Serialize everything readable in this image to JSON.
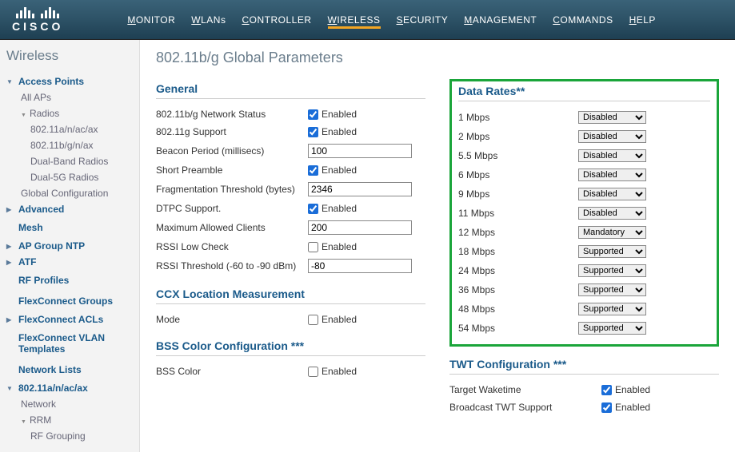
{
  "logo_text": "CISCO",
  "nav": [
    "MONITOR",
    "WLANs",
    "CONTROLLER",
    "WIRELESS",
    "SECURITY",
    "MANAGEMENT",
    "COMMANDS",
    "HELP"
  ],
  "nav_active": "WIRELESS",
  "sidebar": {
    "title": "Wireless",
    "items": [
      {
        "label": "Access Points",
        "type": "top",
        "expanded": true,
        "children": [
          {
            "label": "All APs",
            "type": "sub"
          },
          {
            "label": "Radios",
            "type": "sub",
            "expanded": true,
            "children": [
              {
                "label": "802.11a/n/ac/ax",
                "type": "sub2"
              },
              {
                "label": "802.11b/g/n/ax",
                "type": "sub2"
              },
              {
                "label": "Dual-Band Radios",
                "type": "sub2"
              },
              {
                "label": "Dual-5G Radios",
                "type": "sub2"
              }
            ]
          },
          {
            "label": "Global Configuration",
            "type": "sub"
          }
        ]
      },
      {
        "label": "Advanced",
        "type": "top",
        "expanded": false
      },
      {
        "label": "Mesh",
        "type": "top-nochevron"
      },
      {
        "label": "AP Group NTP",
        "type": "top",
        "expanded": false
      },
      {
        "label": "ATF",
        "type": "top",
        "expanded": false
      },
      {
        "label": "RF Profiles",
        "type": "top-nochevron"
      },
      {
        "label": "FlexConnect Groups",
        "type": "top-nochevron"
      },
      {
        "label": "FlexConnect ACLs",
        "type": "top",
        "expanded": false
      },
      {
        "label": "FlexConnect VLAN Templates",
        "type": "top-nochevron"
      },
      {
        "label": "Network Lists",
        "type": "top-nochevron"
      },
      {
        "label": "802.11a/n/ac/ax",
        "type": "top",
        "expanded": true,
        "children": [
          {
            "label": "Network",
            "type": "sub"
          },
          {
            "label": "RRM",
            "type": "sub",
            "expanded": true,
            "children": [
              {
                "label": "RF Grouping",
                "type": "sub2"
              }
            ]
          }
        ]
      }
    ]
  },
  "main": {
    "title": "802.11b/g Global Parameters",
    "general": {
      "title": "General",
      "rows": [
        {
          "label": "802.11b/g Network Status",
          "type": "checkbox",
          "checked": true,
          "text": "Enabled"
        },
        {
          "label": "802.11g Support",
          "type": "checkbox",
          "checked": true,
          "text": "Enabled"
        },
        {
          "label": "Beacon Period (millisecs)",
          "type": "text",
          "value": "100"
        },
        {
          "label": "Short Preamble",
          "type": "checkbox",
          "checked": true,
          "text": "Enabled"
        },
        {
          "label": "Fragmentation Threshold (bytes)",
          "type": "text",
          "value": "2346"
        },
        {
          "label": "DTPC Support.",
          "type": "checkbox",
          "checked": true,
          "text": "Enabled"
        },
        {
          "label": "Maximum Allowed Clients",
          "type": "text",
          "value": "200"
        },
        {
          "label": "RSSI Low Check",
          "type": "checkbox",
          "checked": false,
          "text": "Enabled"
        },
        {
          "label": "RSSI Threshold (-60 to -90 dBm)",
          "type": "text",
          "value": "-80"
        }
      ]
    },
    "ccx": {
      "title": "CCX Location Measurement",
      "rows": [
        {
          "label": "Mode",
          "type": "checkbox",
          "checked": false,
          "text": "Enabled"
        }
      ]
    },
    "bss": {
      "title": "BSS Color Configuration ***",
      "rows": [
        {
          "label": "BSS Color",
          "type": "checkbox",
          "checked": false,
          "text": "Enabled"
        }
      ]
    },
    "data_rates": {
      "title": "Data Rates**",
      "options": [
        "Disabled",
        "Mandatory",
        "Supported"
      ],
      "rows": [
        {
          "label": "1 Mbps",
          "value": "Disabled"
        },
        {
          "label": "2 Mbps",
          "value": "Disabled"
        },
        {
          "label": "5.5 Mbps",
          "value": "Disabled"
        },
        {
          "label": "6 Mbps",
          "value": "Disabled"
        },
        {
          "label": "9 Mbps",
          "value": "Disabled"
        },
        {
          "label": "11 Mbps",
          "value": "Disabled"
        },
        {
          "label": "12 Mbps",
          "value": "Mandatory"
        },
        {
          "label": "18 Mbps",
          "value": "Supported"
        },
        {
          "label": "24 Mbps",
          "value": "Supported"
        },
        {
          "label": "36 Mbps",
          "value": "Supported"
        },
        {
          "label": "48 Mbps",
          "value": "Supported"
        },
        {
          "label": "54 Mbps",
          "value": "Supported"
        }
      ]
    },
    "twt": {
      "title": "TWT Configuration ***",
      "rows": [
        {
          "label": "Target Waketime",
          "type": "checkbox",
          "checked": true,
          "text": "Enabled"
        },
        {
          "label": "Broadcast TWT Support",
          "type": "checkbox",
          "checked": true,
          "text": "Enabled"
        }
      ]
    }
  }
}
